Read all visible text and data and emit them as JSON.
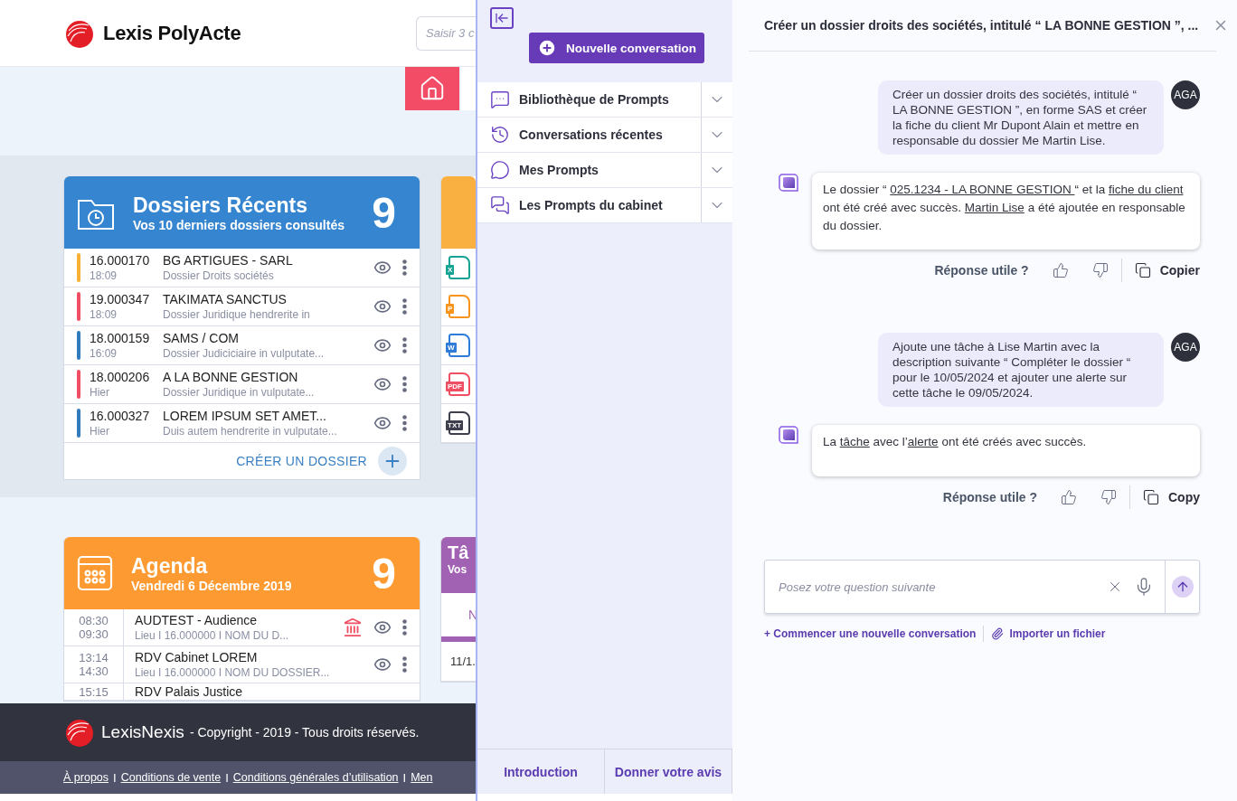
{
  "header": {
    "logo": "Lexis PolyActe",
    "search": {
      "placeholder": "Saisir 3 c"
    }
  },
  "dossiers": {
    "title": "Dossiers Récents",
    "subtitle": "Vos 10 derniers dossiers consultés",
    "count": "9",
    "create": "CRÉER UN DOSSIER",
    "rows": [
      {
        "number": "16.000170",
        "time": "18:09",
        "title": "BG ARTIGUES - SARL",
        "subtitle": "Dossier Droits sociétés",
        "color": "#f8b133"
      },
      {
        "number": "19.000347",
        "time": "18:09",
        "title": "TAKIMATA SANCTUS",
        "subtitle": "Dossier Juridique hendrerite in",
        "color": "#f04e62"
      },
      {
        "number": "18.000159",
        "time": "16:09",
        "title": "SAMS / COM",
        "subtitle": "Dossier Judiciciaire  in vulputate...",
        "color": "#2f7bbd"
      },
      {
        "number": "18.000206",
        "time": "Hier",
        "title": "A LA BONNE GESTION",
        "subtitle": "Dossier Juridique  in vulputate...",
        "color": "#f04e62"
      },
      {
        "number": "16.000327",
        "time": "Hier",
        "title": "LOREM IPSUM SET AMET...",
        "subtitle": "Duis autem hendrerite in vulputate...",
        "color": "#2f7bbd"
      }
    ]
  },
  "files": [
    {
      "label": "X",
      "color": "#16a394"
    },
    {
      "label": "P",
      "color": "#f7941d"
    },
    {
      "label": "W",
      "color": "#2f7bd8"
    },
    {
      "label": "PDF",
      "color": "#f04e62"
    },
    {
      "label": "TXT",
      "color": "#3d3f4d"
    }
  ],
  "agenda": {
    "title": "Agenda",
    "subtitle": "Vendredi 6 Décembre 2019",
    "count": "9",
    "rows": [
      {
        "start": "08:30",
        "end": "09:30",
        "title": "AUDTEST - Audience",
        "meta": "Lieu  I  16.000000  I NOM DU D...",
        "court": true
      },
      {
        "start": "13:14",
        "end": "14:30",
        "title": "RDV Cabinet LOREM",
        "meta": "Lieu  I  16.000000  I NOM DU DOSSIER...",
        "court": false
      },
      {
        "start": "15:15",
        "title": "RDV Palais Justice",
        "court": false
      }
    ]
  },
  "taches": {
    "title": "Tâ",
    "subtitle": "Vos",
    "tab": "N",
    "rows": [
      "11/1."
    ]
  },
  "footer": {
    "brand": "LexisNexis",
    "copyright": "- Copyright - 2019 - Tous droits réservés.",
    "links": [
      {
        "text": "À propos"
      },
      {
        "separator": "I",
        "text": "Conditions de vente"
      },
      {
        "separator": "I",
        "text": "Conditions générales d’utilisation"
      },
      {
        "separator": "I",
        "text": "Men"
      }
    ]
  },
  "assistant": {
    "new_button": "Nouvelle conversation",
    "sections": [
      {
        "label": "Bibliothèque de Prompts",
        "expanded": false
      },
      {
        "label": "Conversations récentes",
        "expanded": false
      },
      {
        "label": "Mes Prompts",
        "expanded": false
      },
      {
        "label": "Les Prompts du cabinet",
        "expanded": false
      }
    ],
    "bottom": [
      "Introduction",
      "Donner votre avis"
    ]
  },
  "chat": {
    "title": "Créer un dossier droits des sociétés, intitulé “ LA BONNE GESTION ”, ...",
    "messages": [
      {
        "kind": "user",
        "avatar": "AGA",
        "text": "Créer un dossier droits des sociétés, intitulé “ LA BONNE GESTION ”, en forme SAS et créer la fiche du client Mr Dupont Alain et mettre en responsable du dossier Me Martin Lise."
      },
      {
        "kind": "bot",
        "parts": [
          {
            "text": "Le dossier “ "
          },
          {
            "text": "025.1234 - LA BONNE GESTION ",
            "link": true
          },
          {
            "text": "“ et la "
          },
          {
            "text": "fiche du client",
            "link": true
          },
          {
            "text": " ont été créé avec succès. "
          },
          {
            "text": "Martin Lise",
            "link": true
          },
          {
            "text": " a été ajoutée en responsable du dossier."
          }
        ],
        "feedback": {
          "question": "Réponse utile ?",
          "copy": "Copier"
        }
      },
      {
        "kind": "user",
        "avatar": "AGA",
        "text": "Ajoute une tâche à Lise Martin avec la description suivante “ Compléter le dossier “ pour le 10/05/2024 et ajouter une alerte sur cette tâche le 09/05/2024."
      },
      {
        "kind": "bot",
        "parts": [
          {
            "text": "La "
          },
          {
            "text": "tâche",
            "link": true
          },
          {
            "text": " avec l’"
          },
          {
            "text": "alerte",
            "link": true
          },
          {
            "text": " ont été créés avec succès."
          }
        ],
        "feedback": {
          "question": "Réponse utile ?",
          "copy": "Copy"
        }
      }
    ],
    "input": {
      "placeholder": "Posez votre question suivante"
    },
    "actions": [
      "+ Commencer une nouvelle conversation",
      "Importer un fichier"
    ]
  }
}
